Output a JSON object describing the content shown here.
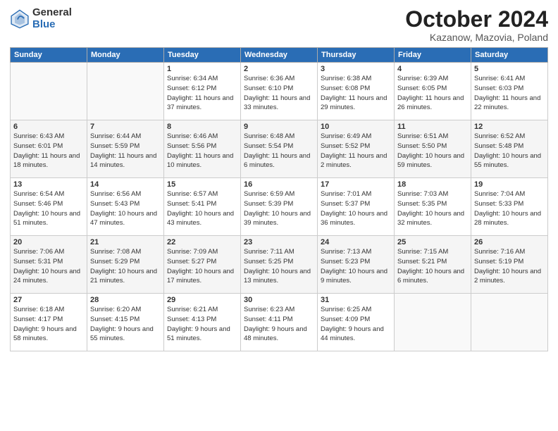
{
  "header": {
    "logo_general": "General",
    "logo_blue": "Blue",
    "title": "October 2024",
    "location": "Kazanow, Mazovia, Poland"
  },
  "weekdays": [
    "Sunday",
    "Monday",
    "Tuesday",
    "Wednesday",
    "Thursday",
    "Friday",
    "Saturday"
  ],
  "weeks": [
    [
      {
        "day": "",
        "sunrise": "",
        "sunset": "",
        "daylight": ""
      },
      {
        "day": "",
        "sunrise": "",
        "sunset": "",
        "daylight": ""
      },
      {
        "day": "1",
        "sunrise": "Sunrise: 6:34 AM",
        "sunset": "Sunset: 6:12 PM",
        "daylight": "Daylight: 11 hours and 37 minutes."
      },
      {
        "day": "2",
        "sunrise": "Sunrise: 6:36 AM",
        "sunset": "Sunset: 6:10 PM",
        "daylight": "Daylight: 11 hours and 33 minutes."
      },
      {
        "day": "3",
        "sunrise": "Sunrise: 6:38 AM",
        "sunset": "Sunset: 6:08 PM",
        "daylight": "Daylight: 11 hours and 29 minutes."
      },
      {
        "day": "4",
        "sunrise": "Sunrise: 6:39 AM",
        "sunset": "Sunset: 6:05 PM",
        "daylight": "Daylight: 11 hours and 26 minutes."
      },
      {
        "day": "5",
        "sunrise": "Sunrise: 6:41 AM",
        "sunset": "Sunset: 6:03 PM",
        "daylight": "Daylight: 11 hours and 22 minutes."
      }
    ],
    [
      {
        "day": "6",
        "sunrise": "Sunrise: 6:43 AM",
        "sunset": "Sunset: 6:01 PM",
        "daylight": "Daylight: 11 hours and 18 minutes."
      },
      {
        "day": "7",
        "sunrise": "Sunrise: 6:44 AM",
        "sunset": "Sunset: 5:59 PM",
        "daylight": "Daylight: 11 hours and 14 minutes."
      },
      {
        "day": "8",
        "sunrise": "Sunrise: 6:46 AM",
        "sunset": "Sunset: 5:56 PM",
        "daylight": "Daylight: 11 hours and 10 minutes."
      },
      {
        "day": "9",
        "sunrise": "Sunrise: 6:48 AM",
        "sunset": "Sunset: 5:54 PM",
        "daylight": "Daylight: 11 hours and 6 minutes."
      },
      {
        "day": "10",
        "sunrise": "Sunrise: 6:49 AM",
        "sunset": "Sunset: 5:52 PM",
        "daylight": "Daylight: 11 hours and 2 minutes."
      },
      {
        "day": "11",
        "sunrise": "Sunrise: 6:51 AM",
        "sunset": "Sunset: 5:50 PM",
        "daylight": "Daylight: 10 hours and 59 minutes."
      },
      {
        "day": "12",
        "sunrise": "Sunrise: 6:52 AM",
        "sunset": "Sunset: 5:48 PM",
        "daylight": "Daylight: 10 hours and 55 minutes."
      }
    ],
    [
      {
        "day": "13",
        "sunrise": "Sunrise: 6:54 AM",
        "sunset": "Sunset: 5:46 PM",
        "daylight": "Daylight: 10 hours and 51 minutes."
      },
      {
        "day": "14",
        "sunrise": "Sunrise: 6:56 AM",
        "sunset": "Sunset: 5:43 PM",
        "daylight": "Daylight: 10 hours and 47 minutes."
      },
      {
        "day": "15",
        "sunrise": "Sunrise: 6:57 AM",
        "sunset": "Sunset: 5:41 PM",
        "daylight": "Daylight: 10 hours and 43 minutes."
      },
      {
        "day": "16",
        "sunrise": "Sunrise: 6:59 AM",
        "sunset": "Sunset: 5:39 PM",
        "daylight": "Daylight: 10 hours and 39 minutes."
      },
      {
        "day": "17",
        "sunrise": "Sunrise: 7:01 AM",
        "sunset": "Sunset: 5:37 PM",
        "daylight": "Daylight: 10 hours and 36 minutes."
      },
      {
        "day": "18",
        "sunrise": "Sunrise: 7:03 AM",
        "sunset": "Sunset: 5:35 PM",
        "daylight": "Daylight: 10 hours and 32 minutes."
      },
      {
        "day": "19",
        "sunrise": "Sunrise: 7:04 AM",
        "sunset": "Sunset: 5:33 PM",
        "daylight": "Daylight: 10 hours and 28 minutes."
      }
    ],
    [
      {
        "day": "20",
        "sunrise": "Sunrise: 7:06 AM",
        "sunset": "Sunset: 5:31 PM",
        "daylight": "Daylight: 10 hours and 24 minutes."
      },
      {
        "day": "21",
        "sunrise": "Sunrise: 7:08 AM",
        "sunset": "Sunset: 5:29 PM",
        "daylight": "Daylight: 10 hours and 21 minutes."
      },
      {
        "day": "22",
        "sunrise": "Sunrise: 7:09 AM",
        "sunset": "Sunset: 5:27 PM",
        "daylight": "Daylight: 10 hours and 17 minutes."
      },
      {
        "day": "23",
        "sunrise": "Sunrise: 7:11 AM",
        "sunset": "Sunset: 5:25 PM",
        "daylight": "Daylight: 10 hours and 13 minutes."
      },
      {
        "day": "24",
        "sunrise": "Sunrise: 7:13 AM",
        "sunset": "Sunset: 5:23 PM",
        "daylight": "Daylight: 10 hours and 9 minutes."
      },
      {
        "day": "25",
        "sunrise": "Sunrise: 7:15 AM",
        "sunset": "Sunset: 5:21 PM",
        "daylight": "Daylight: 10 hours and 6 minutes."
      },
      {
        "day": "26",
        "sunrise": "Sunrise: 7:16 AM",
        "sunset": "Sunset: 5:19 PM",
        "daylight": "Daylight: 10 hours and 2 minutes."
      }
    ],
    [
      {
        "day": "27",
        "sunrise": "Sunrise: 6:18 AM",
        "sunset": "Sunset: 4:17 PM",
        "daylight": "Daylight: 9 hours and 58 minutes."
      },
      {
        "day": "28",
        "sunrise": "Sunrise: 6:20 AM",
        "sunset": "Sunset: 4:15 PM",
        "daylight": "Daylight: 9 hours and 55 minutes."
      },
      {
        "day": "29",
        "sunrise": "Sunrise: 6:21 AM",
        "sunset": "Sunset: 4:13 PM",
        "daylight": "Daylight: 9 hours and 51 minutes."
      },
      {
        "day": "30",
        "sunrise": "Sunrise: 6:23 AM",
        "sunset": "Sunset: 4:11 PM",
        "daylight": "Daylight: 9 hours and 48 minutes."
      },
      {
        "day": "31",
        "sunrise": "Sunrise: 6:25 AM",
        "sunset": "Sunset: 4:09 PM",
        "daylight": "Daylight: 9 hours and 44 minutes."
      },
      {
        "day": "",
        "sunrise": "",
        "sunset": "",
        "daylight": ""
      },
      {
        "day": "",
        "sunrise": "",
        "sunset": "",
        "daylight": ""
      }
    ]
  ]
}
